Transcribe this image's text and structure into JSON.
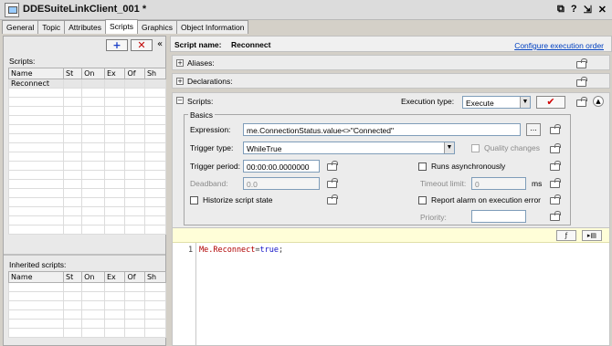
{
  "window": {
    "title": "DDESuiteLinkClient_001 *",
    "controls": [
      "⧉",
      "?",
      "⇲",
      "✕"
    ]
  },
  "tabs": [
    "General",
    "Topic",
    "Attributes",
    "Scripts",
    "Graphics",
    "Object Information"
  ],
  "left_panel": {
    "add_symbol": "+",
    "delete_symbol": "✕",
    "collapse_symbol": "«",
    "scripts_label": "Scripts:",
    "columns": [
      "Name",
      "St",
      "On",
      "Ex",
      "Of",
      "Sh"
    ],
    "scripts": [
      "Reconnect"
    ],
    "inherited_label": "Inherited scripts:",
    "inherited_columns": [
      "Name",
      "St",
      "On",
      "Ex",
      "Of",
      "Sh"
    ]
  },
  "header": {
    "script_name_label": "Script name:",
    "script_name": "Reconnect",
    "configure_link": "Configure execution order"
  },
  "sections": {
    "aliases": "Aliases:",
    "declarations": "Declarations:",
    "scripts": "Scripts:"
  },
  "execution": {
    "label": "Execution type:",
    "value": "Execute",
    "ok_symbol": "✔"
  },
  "basics": {
    "title": "Basics",
    "expression_label": "Expression:",
    "expression_value": "me.ConnectionStatus.value<>\"Connected\"",
    "expression_button": "...",
    "trigger_type_label": "Trigger type:",
    "trigger_type_value": "WhileTrue",
    "quality_changes": "Quality changes",
    "trigger_period_label": "Trigger period:",
    "trigger_period_value": "00:00:00.0000000",
    "runs_async": "Runs asynchronously",
    "deadband_label": "Deadband:",
    "deadband_value": "0.0",
    "timeout_label": "Timeout limit:",
    "timeout_value": "0",
    "timeout_unit": "ms",
    "historize": "Historize script state",
    "report_alarm": "Report alarm on execution error",
    "priority_label": "Priority:",
    "priority_value": ""
  },
  "editor": {
    "line_number": "1",
    "code_object": "Me.Reconnect",
    "code_operator": "=",
    "code_value": "true",
    "code_end": ";"
  }
}
